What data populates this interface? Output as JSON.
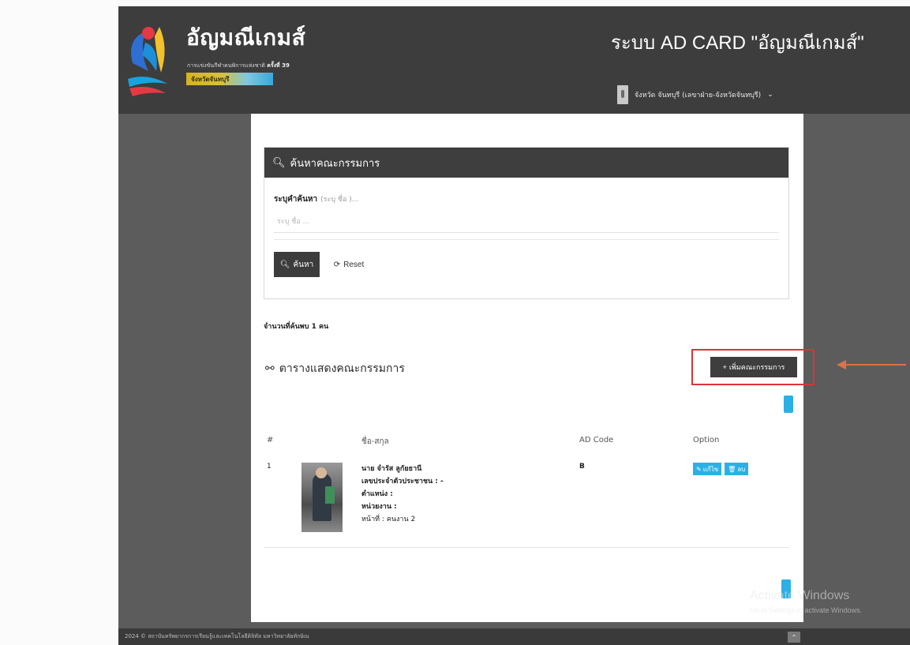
{
  "header": {
    "logo_title": "อัญมณีเกมส์",
    "logo_subtitle": "การแข่งขันกีฬาคนพิการแห่งชาติ",
    "logo_edition": "ครั้งที่ 39",
    "logo_tag": "จังหวัดจันทบุรี",
    "system_title": "ระบบ AD CARD \"อัญมณีเกมส์\"",
    "user_label": "จังหวัด จันทบุรี (เลขาฝ่าย-จังหวัดจันทบุรี)"
  },
  "search": {
    "heading": "ค้นหาคณะกรรมการ",
    "field_label": "ระบุคำค้นหา",
    "field_hint": "(ระบุ ชื่อ )...",
    "placeholder": "ระบุ ชื่อ ...",
    "search_button": "ค้นหา",
    "reset_button": "Reset"
  },
  "results": {
    "count_text": "จำนวนที่ค้นพบ 1 คน"
  },
  "table": {
    "title": "ตารางแสดงคณะกรรมการ",
    "add_button": "เพิ่มคณะกรรมการ",
    "columns": [
      "#",
      "ชื่อ-สกุล",
      "AD Code",
      "Option"
    ],
    "rows": [
      {
        "index": "1",
        "name": "นาย จำรัส ลูกัยธานี",
        "id_card": "เลขประจำตัวประชาชน : -",
        "position": "ตำแหน่ง :",
        "unit": "หน่วยงาน :",
        "duty": "หน้าที่ : คนงาน 2",
        "ad_code": "B",
        "edit_label": "แก้ไข",
        "delete_label": "ลบ"
      }
    ]
  },
  "watermark": {
    "title": "Activate Windows",
    "subtitle": "Go to Settings to activate Windows."
  },
  "footer": {
    "text": "2024 © สถาบันทรัพยากรการเรียนรู้และเทคโนโลยีดิจิทัล มหาวิทยาลัยทักษิณ"
  },
  "colors": {
    "header_bg": "#3d3d3d",
    "page_bg": "#5c5c5c",
    "accent_blue": "#2bb0e6",
    "highlight_red": "#d9343a",
    "arrow": "#d9734a"
  }
}
